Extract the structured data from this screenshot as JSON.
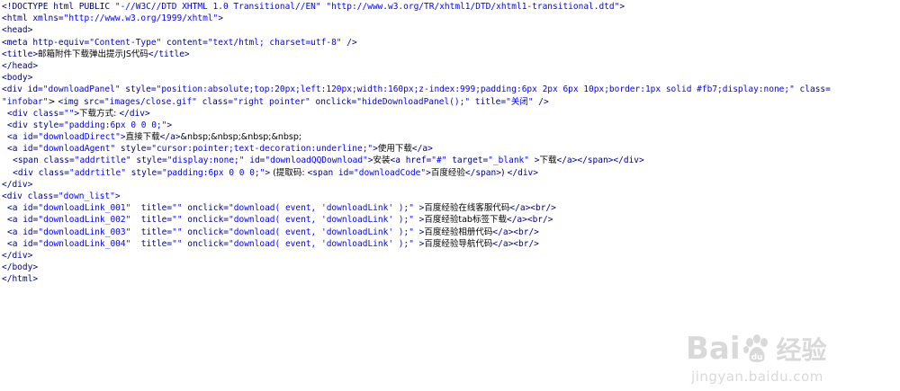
{
  "code_lines": [
    "<!DOCTYPE html PUBLIC \"-//W3C//DTD XHTML 1.0 Transitional//EN\" \"http://www.w3.org/TR/xhtml1/DTD/xhtml1-transitional.dtd\">",
    "<html xmlns=\"http://www.w3.org/1999/xhtml\">",
    "<head>",
    "<meta http-equiv=\"Content-Type\" content=\"text/html; charset=utf-8\" />",
    "<title>邮箱附件下载弹出提示JS代码</title>",
    "</head>",
    "<body>",
    "<div id=\"downloadPanel\" style=\"position:absolute;top:20px;left:120px;width:160px;z-index:999;padding:6px 2px 6px 10px;border:1px solid #fb7;display:none;\" class=",
    "\"infobar\"> <img src=\"images/close.gif\" class=\"right pointer\" onclick=\"hideDownloadPanel();\" title=\"关闭\" />",
    "  <div class=\"\">下载方式: </div>",
    "  <div style=\"padding:6px 0 0 0;\">",
    "  <a id=\"downloadDirect\">直接下载</a>&nbsp;&nbsp;&nbsp;&nbsp;",
    "  <a id=\"downloadAgent\" style=\"cursor:pointer;text-decoration:underline;\">使用下载</a>",
    "    <span class=\"addrtitle\" style=\"display:none;\" id=\"downloadQQDownload\">安装<a href=\"#\" target=\"_blank\" >下载</a></span></div>",
    "    <div class=\"addrtitle\" style=\"padding:6px 0 0 0;\"> (提取码: <span id=\"downloadCode\">百度经验</span>) </div>",
    "</div>",
    "<div class=\"down_list\">",
    "  <a id=\"downloadLink_001\"  title=\"\" onclick=\"download( event, 'downloadLink' );\" >百度经验在线客服代码</a><br/>",
    "  <a id=\"downloadLink_002\"  title=\"\" onclick=\"download( event, 'downloadLink' );\" >百度经验tab标签下载</a><br/>",
    "  <a id=\"downloadLink_003\"  title=\"\" onclick=\"download( event, 'downloadLink' );\" >百度经验相册代码</a><br/>",
    "  <a id=\"downloadLink_004\"  title=\"\" onclick=\"download( event, 'downloadLink' );\" >百度经验导航代码</a><br/>",
    "</div>",
    "</body>",
    "</html>"
  ],
  "watermark": {
    "logo_left": "Bai",
    "logo_right": "经验",
    "url": "jingyan.baidu.com",
    "paw_icon": "baidu-paw-icon",
    "color": "#d9d9d9"
  },
  "colors": {
    "tag": "#000080",
    "value": "#0000ff",
    "text": "#000000",
    "background": "#ffffff"
  }
}
